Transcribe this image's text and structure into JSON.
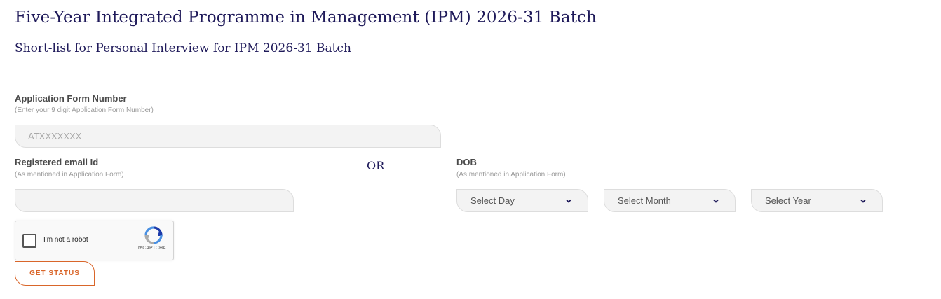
{
  "header": {
    "title": "Five-Year Integrated Programme in Management (IPM) 2026-31 Batch",
    "subtitle": "Short-list for Personal Interview for IPM 2026-31 Batch"
  },
  "form": {
    "application": {
      "label": "Application Form Number",
      "hint": "(Enter your 9 digit Application Form Number)",
      "placeholder": "ATXXXXXXX",
      "value": ""
    },
    "email": {
      "label": "Registered email Id",
      "hint": "(As mentioned in Application Form)",
      "placeholder": "",
      "value": ""
    },
    "separator": "OR",
    "dob": {
      "label": "DOB",
      "hint": "(As mentioned in Application Form)",
      "day": "Select Day",
      "month": "Select Month",
      "year": "Select Year"
    },
    "captcha": {
      "text": "I'm not a robot",
      "brand": "reCAPTCHA",
      "checked": false
    },
    "submit_label": "GET STATUS"
  },
  "colors": {
    "heading": "#1f1a5a",
    "accent": "#d9662a",
    "field_bg": "#f3f3f3"
  },
  "icons": {
    "dropdown": "chevron-down-icon",
    "captcha": "recaptcha-logo-icon"
  }
}
